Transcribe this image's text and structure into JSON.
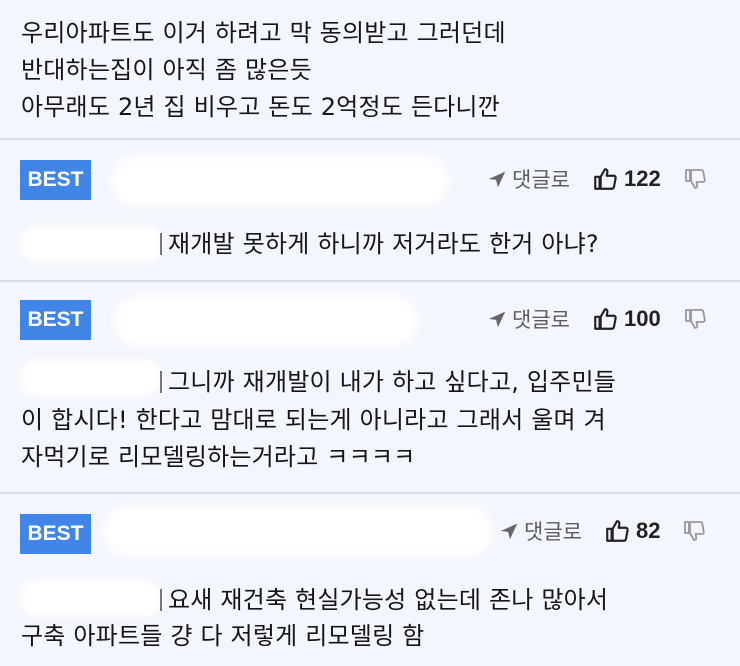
{
  "top_post": {
    "lines": [
      "우리아파트도 이거 하려고 막 동의받고 그러던데",
      "반대하는집이 아직 좀 많은듯",
      "아무래도 2년 집 비우고 돈도 2억정도 든다니깐"
    ]
  },
  "comments": [
    {
      "badge": "BEST",
      "reply_label": "댓글로",
      "likes": "122",
      "lines": [
        "재개발 못하게 하니까 저거라도 한거 아냐?"
      ]
    },
    {
      "badge": "BEST",
      "reply_label": "댓글로",
      "likes": "100",
      "lines": [
        "그니까 재개발이 내가 하고 싶다고, 입주민들",
        "이 합시다! 한다고 맘대로 되는게 아니라고 그래서 울며 겨",
        "자먹기로 리모델링하는거라고 ㅋㅋㅋㅋ"
      ]
    },
    {
      "badge": "BEST",
      "reply_label": "댓글로",
      "likes": "82",
      "lines": [
        "요새 재건축 현실가능성 없는데 존나 많아서",
        "구축 아파트들 걍 다 저렇게 리모델링 함"
      ]
    }
  ]
}
